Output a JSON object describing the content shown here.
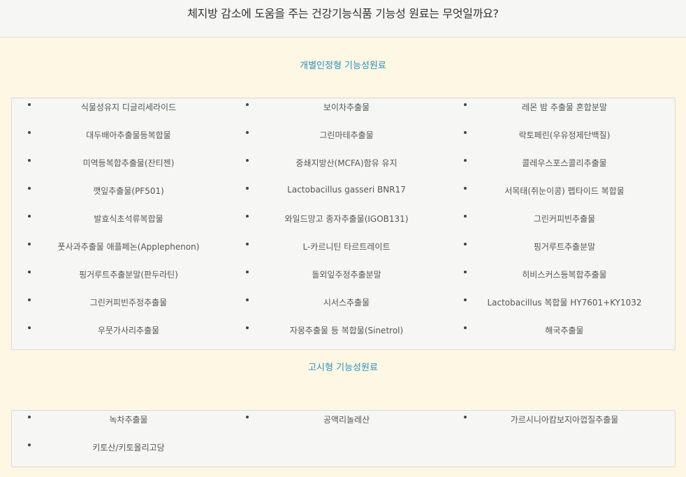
{
  "header": {
    "title": "체지방 감소에 도움을 주는 건강기능식품 기능성 원료는 무엇일까요?"
  },
  "individual": {
    "title": "개별인정형 기능성원료",
    "items": [
      "식물성유지 디글리세라이드",
      "보이차추출물",
      "레몬 밤 추출물 혼합분말",
      "대두배아추출물등복합물",
      "그린마테추출물",
      "락토페린(우유정제단백질)",
      "미역등복합추출물(잔티젠)",
      "중쇄지방산(MCFA)함유 유지",
      "콜레우스포스콜리추출물",
      "깻잎추출물(PF501)",
      "Lactobacillus gasseri BNR17",
      "서목태(쥐눈이콩) 펩타이드 복합물",
      "발효식초석류복합물",
      "와일드망고 종자추출물(IGOB131)",
      "그린커피빈추출물",
      "풋사과추출물 애플페논(Applephenon)",
      "L-카르니틴 타르트레이트",
      "핑거루트추출분말",
      "핑거루트추출분말(판두라틴)",
      "돌외잎주정추출분말",
      "히비스커스등복합추출물",
      "그린커피빈주정추출물",
      "시서스추출물",
      "Lactobacillus 복합물 HY7601+KY1032",
      "우뭇가사리추출물",
      "자몽추출물 등 복합물(Sinetrol)",
      "해국추출물"
    ]
  },
  "notified": {
    "title": "고시형 기능성원료",
    "items": [
      "녹차추출물",
      "공액리놀레산",
      "가르시니아캄보지아껍질추출물",
      "키토산/키토올리고당"
    ]
  }
}
